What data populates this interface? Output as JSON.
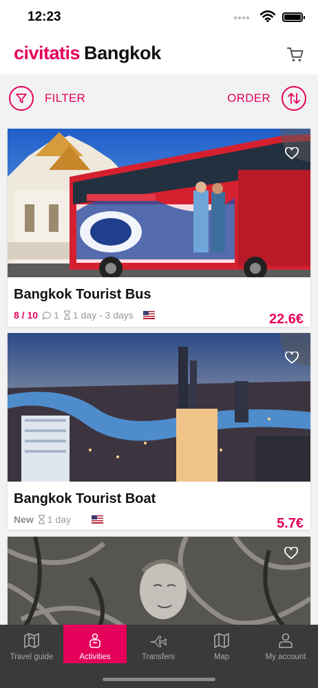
{
  "status_bar": {
    "time": "12:23"
  },
  "header": {
    "brand": "civitatis",
    "city": "Bangkok"
  },
  "toolbar": {
    "filter_label": "FILTER",
    "order_label": "ORDER"
  },
  "activities": [
    {
      "title": "Bangkok Tourist Bus",
      "rating": "8 / 10",
      "reviews": "1",
      "duration": "1 day - 3 days",
      "price": "22.6€"
    },
    {
      "title": "Bangkok Tourist Boat",
      "tag": "New",
      "duration": "1 day",
      "price": "5.7€"
    },
    {
      "title": ""
    }
  ],
  "tabbar": {
    "items": [
      {
        "label": "Travel guide"
      },
      {
        "label": "Activities",
        "active": true
      },
      {
        "label": "Transfers"
      },
      {
        "label": "Map"
      },
      {
        "label": "My account"
      }
    ]
  },
  "colors": {
    "accent": "#e4005b",
    "tabbar_bg": "#3a3a3a",
    "list_bg": "#f2f2f2"
  }
}
